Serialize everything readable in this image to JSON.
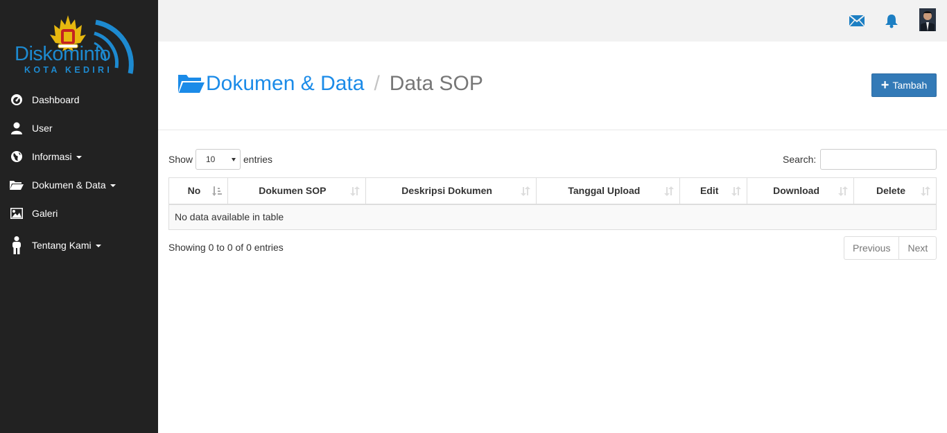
{
  "brand": {
    "name": "Diskominfo",
    "subtitle": "KOTA KEDIRI",
    "color": "#1d8ad0"
  },
  "sidebar": {
    "items": [
      {
        "label": "Dashboard",
        "icon": "dashboard-icon",
        "dropdown": false
      },
      {
        "label": "User",
        "icon": "user-icon",
        "dropdown": false
      },
      {
        "label": "Informasi",
        "icon": "globe-icon",
        "dropdown": true
      },
      {
        "label": "Dokumen & Data",
        "icon": "folder-open-icon",
        "dropdown": true
      },
      {
        "label": "Galeri",
        "icon": "picture-icon",
        "dropdown": false
      },
      {
        "label": "Tentang Kami",
        "icon": "person-icon",
        "dropdown": true
      }
    ]
  },
  "topbar": {
    "icons": [
      "envelope-icon",
      "bell-icon",
      "avatar"
    ]
  },
  "header": {
    "breadcrumb_main": "Dokumen & Data",
    "separator": "/",
    "breadcrumb_sub": "Data SOP",
    "add_button": "Tambah"
  },
  "controls": {
    "show_label": "Show",
    "length_value": "10",
    "entries_label": "entries",
    "search_label": "Search:",
    "search_value": ""
  },
  "table": {
    "columns": [
      "No",
      "Dokumen SOP",
      "Deskripsi Dokumen",
      "Tanggal Upload",
      "Edit",
      "Download",
      "Delete"
    ],
    "empty_message": "No data available in table"
  },
  "footer": {
    "info": "Showing 0 to 0 of 0 entries",
    "previous": "Previous",
    "next": "Next"
  },
  "colors": {
    "sidebar_bg": "#222222",
    "accent": "#1b8be8",
    "button": "#337ab7"
  }
}
